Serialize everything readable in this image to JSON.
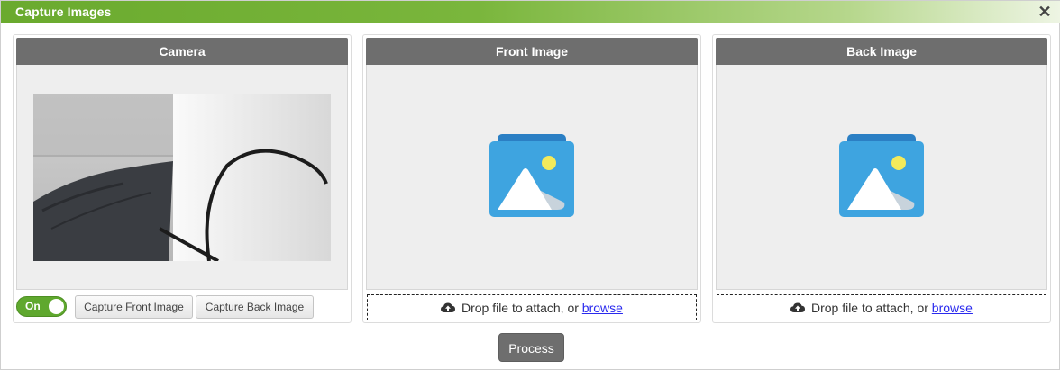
{
  "dialog": {
    "title": "Capture Images",
    "close_glyph": "✕"
  },
  "camera_panel": {
    "title": "Camera",
    "toggle_label": "On",
    "capture_front_label": "Capture Front Image",
    "capture_back_label": "Capture Back Image"
  },
  "front_panel": {
    "title": "Front Image",
    "drop_text": "Drop file to attach, or",
    "browse_label": "browse"
  },
  "back_panel": {
    "title": "Back Image",
    "drop_text": "Drop file to attach, or",
    "browse_label": "browse"
  },
  "footer": {
    "process_label": "Process"
  },
  "colors": {
    "title_bar": "#7ab63c",
    "panel_header": "#6e6e6e",
    "toggle_on": "#5fa82e",
    "image_icon": "#3fa0dc"
  },
  "icons": [
    "close-icon",
    "cloud-upload-icon",
    "image-placeholder-icon"
  ]
}
